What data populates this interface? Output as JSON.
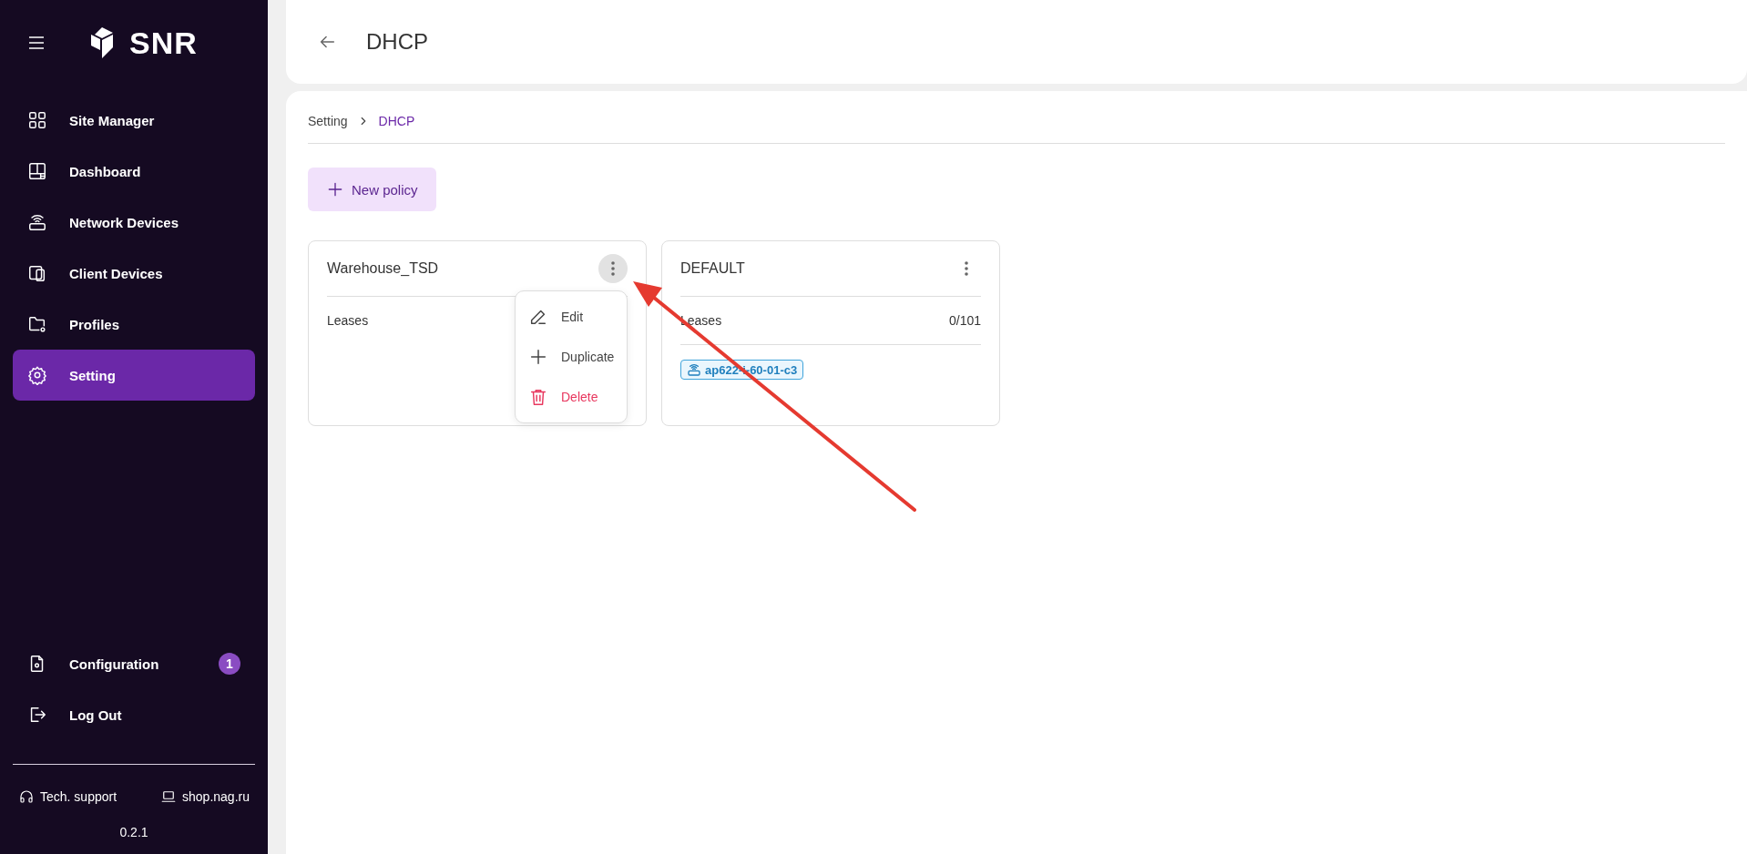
{
  "sidebar": {
    "logo": "SNR",
    "items": [
      {
        "label": "Site Manager",
        "selected": false
      },
      {
        "label": "Dashboard",
        "selected": false
      },
      {
        "label": "Network Devices",
        "selected": false
      },
      {
        "label": "Client Devices",
        "selected": false
      },
      {
        "label": "Profiles",
        "selected": false
      },
      {
        "label": "Setting",
        "selected": true
      }
    ],
    "bottom_items": [
      {
        "label": "Configuration",
        "badge": "1"
      },
      {
        "label": "Log Out"
      }
    ],
    "footer_links": [
      {
        "label": "Tech. support"
      },
      {
        "label": "shop.nag.ru"
      }
    ],
    "version": "0.2.1"
  },
  "header": {
    "title": "DHCP"
  },
  "breadcrumb": [
    "Setting",
    "DHCP"
  ],
  "new_policy_button": "New policy",
  "policies": [
    {
      "name": "Warehouse_TSD",
      "menu_open": true,
      "leases_label": "Leases"
    },
    {
      "name": "DEFAULT",
      "menu_open": false,
      "leases_label": "Leases",
      "leases_value": "0/101",
      "devices": [
        "ap622-i-60-01-c3"
      ]
    }
  ],
  "menu": {
    "items": [
      {
        "kind": "edit",
        "label": "Edit"
      },
      {
        "kind": "duplicate",
        "label": "Duplicate"
      },
      {
        "kind": "delete",
        "label": "Delete"
      }
    ]
  }
}
